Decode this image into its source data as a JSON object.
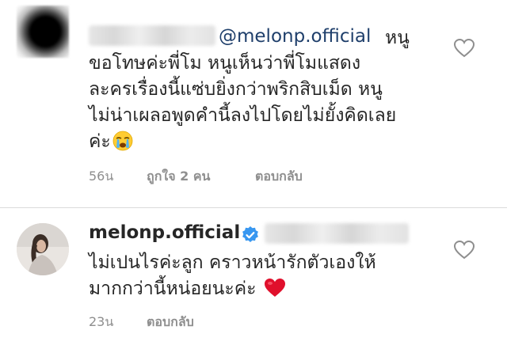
{
  "comment1": {
    "mention": "@melonp.official",
    "text_lines": [
      "หนู",
      "ขอโทษค่ะพี่โม หนูเห็นว่าพี่โมแสดง",
      "ละครเรื่องนี้แซ่บยิ่งกว่าพริกสิบเม็ด หนู",
      "ไม่น่าเผลอพูดคำนี้ลงไปโดยไม่ยั้งคิดเลย",
      "ค่ะ"
    ],
    "emoji": "crying-face",
    "time": "56น",
    "likes": "ถูกใจ 2 คน",
    "reply": "ตอบกลับ"
  },
  "comment2": {
    "author": "melonp.official",
    "text_lines": [
      "ไม่เปนไรค่ะลูก คราวหน้ารักตัวเองให้",
      "มากกว่านี้หน่อยนะค่ะ"
    ],
    "emoji": "red-heart",
    "time": "23น",
    "reply": "ตอบกลับ"
  },
  "colors": {
    "mention": "#1f3f6b",
    "meta": "#8e8e8e",
    "verified": "#3897f0",
    "heart_emoji": "#e0102c"
  }
}
